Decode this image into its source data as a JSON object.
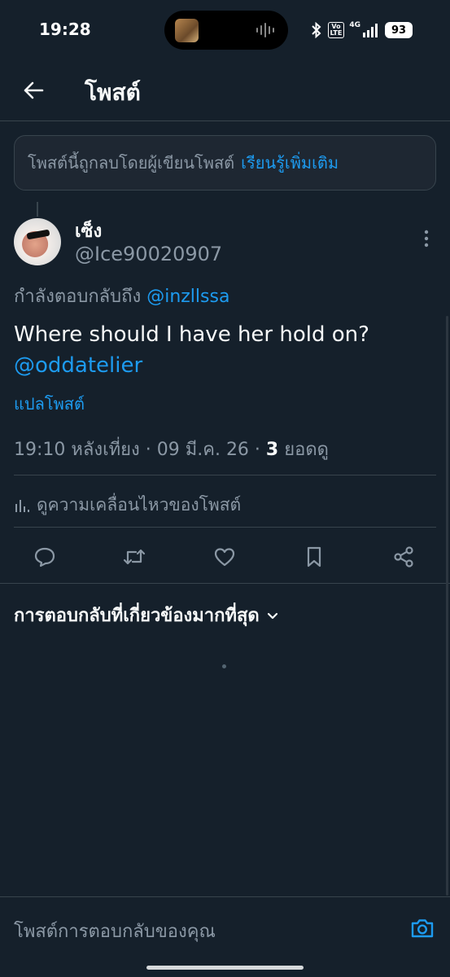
{
  "status_bar": {
    "time": "19:28",
    "volte_top": "Vo",
    "volte_bottom": "LTE",
    "network": "4G",
    "battery": "93"
  },
  "header": {
    "title": "โพสต์",
    "back_icon": "arrow-left-icon"
  },
  "notice": {
    "text": "โพสต์นี้ถูกลบโดยผู้เขียนโพสต์",
    "link": "เรียนรู้เพิ่มเติม"
  },
  "post": {
    "display_name": "เซ็ง",
    "handle": "@Ice90020907",
    "replying_prefix": "กำลังตอบกลับถึง",
    "replying_to": "@inzllssa",
    "text": "Where should I have her hold on?",
    "text_mention": "@oddatelier",
    "translate": "แปลโพสต์",
    "meta_time": "19:10 หลังเที่ยง · 09 มี.ค. 26 · ",
    "meta_views_count": "3",
    "meta_views_label": " ยอดดู",
    "activity": "ดูความเคลื่อนไหวของโพสต์"
  },
  "actions": [
    "reply-icon",
    "repost-icon",
    "like-icon",
    "bookmark-icon",
    "share-icon"
  ],
  "replies": {
    "sort_label": "การตอบกลับที่เกี่ยวข้องมากที่สุด"
  },
  "composer": {
    "placeholder": "โพสต์การตอบกลับของคุณ"
  },
  "colors": {
    "background": "#15202b",
    "accent": "#1d9bf0",
    "secondary_text": "#8b98a5",
    "border": "#38444d"
  }
}
